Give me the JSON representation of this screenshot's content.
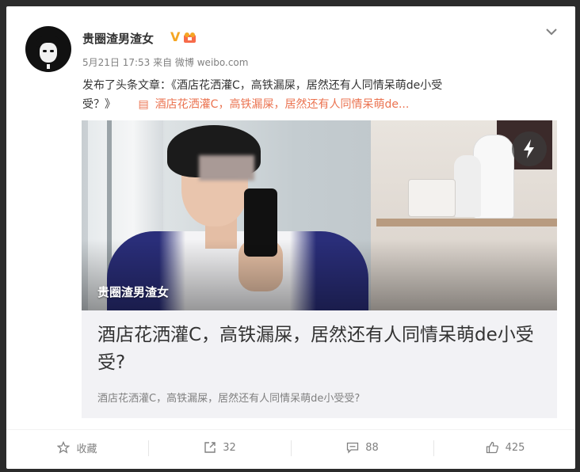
{
  "post": {
    "username": "贵圈渣男渣女",
    "meta": "5月21日 17:53 来自 微博 weibo.com",
    "text": "发布了头条文章：《酒店花洒灌C，高铁漏屎，居然还有人同情呆萌de小受",
    "text_line2": "受？》",
    "article_link": "酒店花洒灌C，高铁漏屎，居然还有人同情呆萌de..."
  },
  "article": {
    "photo_caption": "贵圈渣男渣女",
    "title": "酒店花洒灌C，高铁漏屎，居然还有人同情呆萌de小受受?",
    "description": "酒店花洒灌C，高铁漏屎，居然还有人同情呆萌de小受受?"
  },
  "actions": {
    "favorite_label": "收藏",
    "repost_count": "32",
    "comment_count": "88",
    "like_count": "425"
  },
  "colors": {
    "link": "#eb7350",
    "verified": "#f5a623",
    "background": "#2b2b2b"
  },
  "icons": [
    "v-verified-icon",
    "member-icon",
    "chevron-down-icon",
    "article-doc-icon",
    "flash-icon",
    "star-icon",
    "repost-icon",
    "comment-icon",
    "like-icon"
  ]
}
